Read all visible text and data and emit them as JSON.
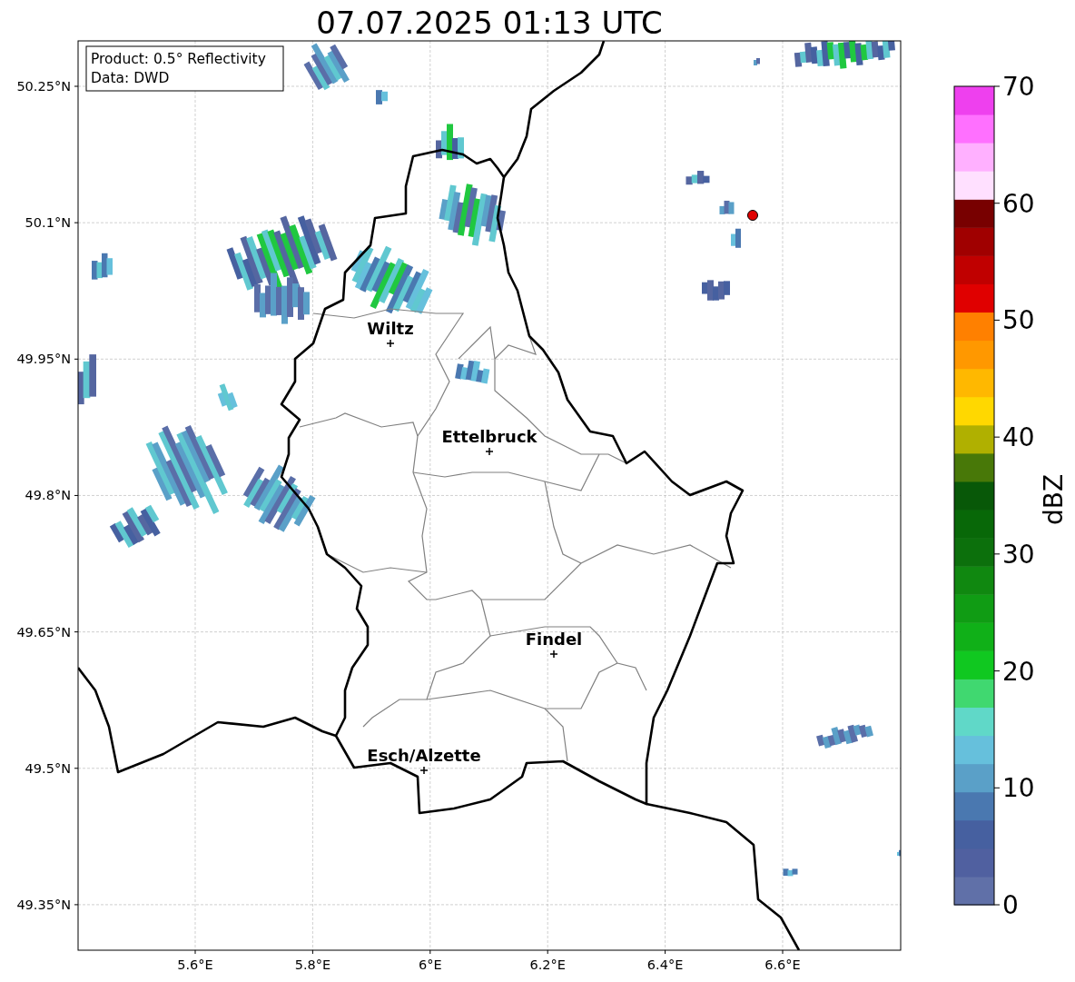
{
  "title": "07.07.2025 01:13 UTC",
  "info_box": {
    "lines": [
      "Product: 0.5° Reflectivity",
      "Data: DWD"
    ]
  },
  "latitude_ticks": [
    "50.25°N",
    "50.1°N",
    "49.95°N",
    "49.8°N",
    "49.65°N",
    "49.5°N",
    "49.35°N"
  ],
  "longitude_ticks": [
    "5.6°E",
    "5.8°E",
    "6°E",
    "6.2°E",
    "6.4°E",
    "6.6°E"
  ],
  "cities": [
    {
      "name": "Wiltz"
    },
    {
      "name": "Ettelbruck"
    },
    {
      "name": "Findel"
    },
    {
      "name": "Esch/Alzette"
    }
  ],
  "colorbar": {
    "label": "dBZ",
    "ticks": [
      "70",
      "60",
      "50",
      "40",
      "30",
      "20",
      "10",
      "0"
    ],
    "bins": [
      {
        "color": "#6070a8"
      },
      {
        "color": "#5060a0"
      },
      {
        "color": "#4660a0"
      },
      {
        "color": "#4a78b0"
      },
      {
        "color": "#5aa0c8"
      },
      {
        "color": "#66c0dc"
      },
      {
        "color": "#60d8c8"
      },
      {
        "color": "#40d870"
      },
      {
        "color": "#10c820"
      },
      {
        "color": "#10b018"
      },
      {
        "color": "#109c14"
      },
      {
        "color": "#108810"
      },
      {
        "color": "#0c700c"
      },
      {
        "color": "#086808"
      },
      {
        "color": "#085808"
      },
      {
        "color": "#487808"
      },
      {
        "color": "#b0b000"
      },
      {
        "color": "#ffd800"
      },
      {
        "color": "#ffb800"
      },
      {
        "color": "#ff9800"
      },
      {
        "color": "#ff8000"
      },
      {
        "color": "#e00000"
      },
      {
        "color": "#c00000"
      },
      {
        "color": "#a00000"
      },
      {
        "color": "#780000"
      },
      {
        "color": "#ffe0ff"
      },
      {
        "color": "#ffb0ff"
      },
      {
        "color": "#ff70ff"
      },
      {
        "color": "#ee40ee"
      }
    ]
  }
}
